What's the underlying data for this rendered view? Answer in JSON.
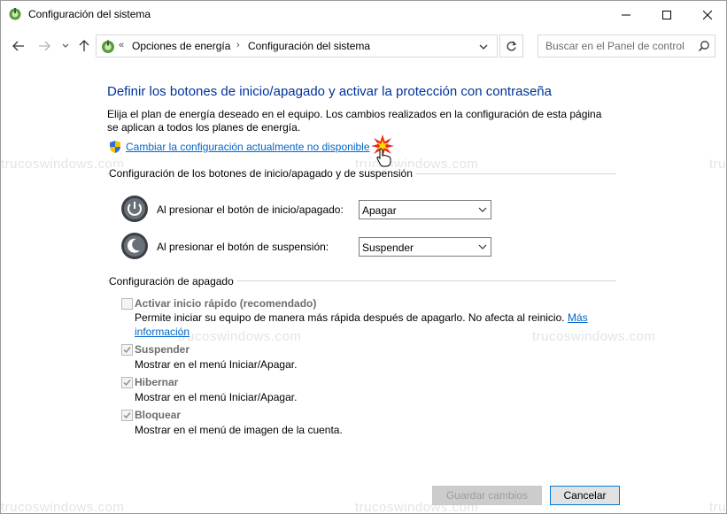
{
  "window": {
    "title": "Configuración del sistema"
  },
  "address_bar": {
    "chevrons": "«",
    "breadcrumb_1": "Opciones de energía",
    "separator": "›",
    "breadcrumb_2": "Configuración del sistema"
  },
  "search": {
    "placeholder": "Buscar en el Panel de control"
  },
  "page": {
    "heading": "Definir los botones de inicio/apagado y activar la protección con contraseña",
    "description": "Elija el plan de energía deseado en el equipo. Los cambios realizados en la configuración de esta página se aplican a todos los planes de energía.",
    "change_link": "Cambiar la configuración actualmente no disponible"
  },
  "buttons_section": {
    "title": "Configuración de los botones de inicio/apagado y de suspensión",
    "power_label": "Al presionar el botón de inicio/apagado:",
    "power_value": "Apagar",
    "sleep_label": "Al presionar el botón de suspensión:",
    "sleep_value": "Suspender"
  },
  "shutdown_section": {
    "title": "Configuración de apagado",
    "items": [
      {
        "label": "Activar inicio rápido (recomendado)",
        "checked": false,
        "desc_line1": "Permite iniciar su equipo de manera más rápida después de apagarlo. No afecta al reinicio.",
        "link_part1": "Más",
        "link_part2": "información"
      },
      {
        "label": "Suspender",
        "checked": true,
        "desc": "Mostrar en el menú Iniciar/Apagar."
      },
      {
        "label": "Hibernar",
        "checked": true,
        "desc": "Mostrar en el menú Iniciar/Apagar."
      },
      {
        "label": "Bloquear",
        "checked": true,
        "desc": "Mostrar en el menú de imagen de la cuenta."
      }
    ]
  },
  "footer": {
    "save_label": "Guardar cambios",
    "cancel_label": "Cancelar"
  },
  "watermark": {
    "text": "trucoswindows.com"
  },
  "colors": {
    "heading": "#003399",
    "link": "#0066cc",
    "accent": "#0078d7"
  }
}
